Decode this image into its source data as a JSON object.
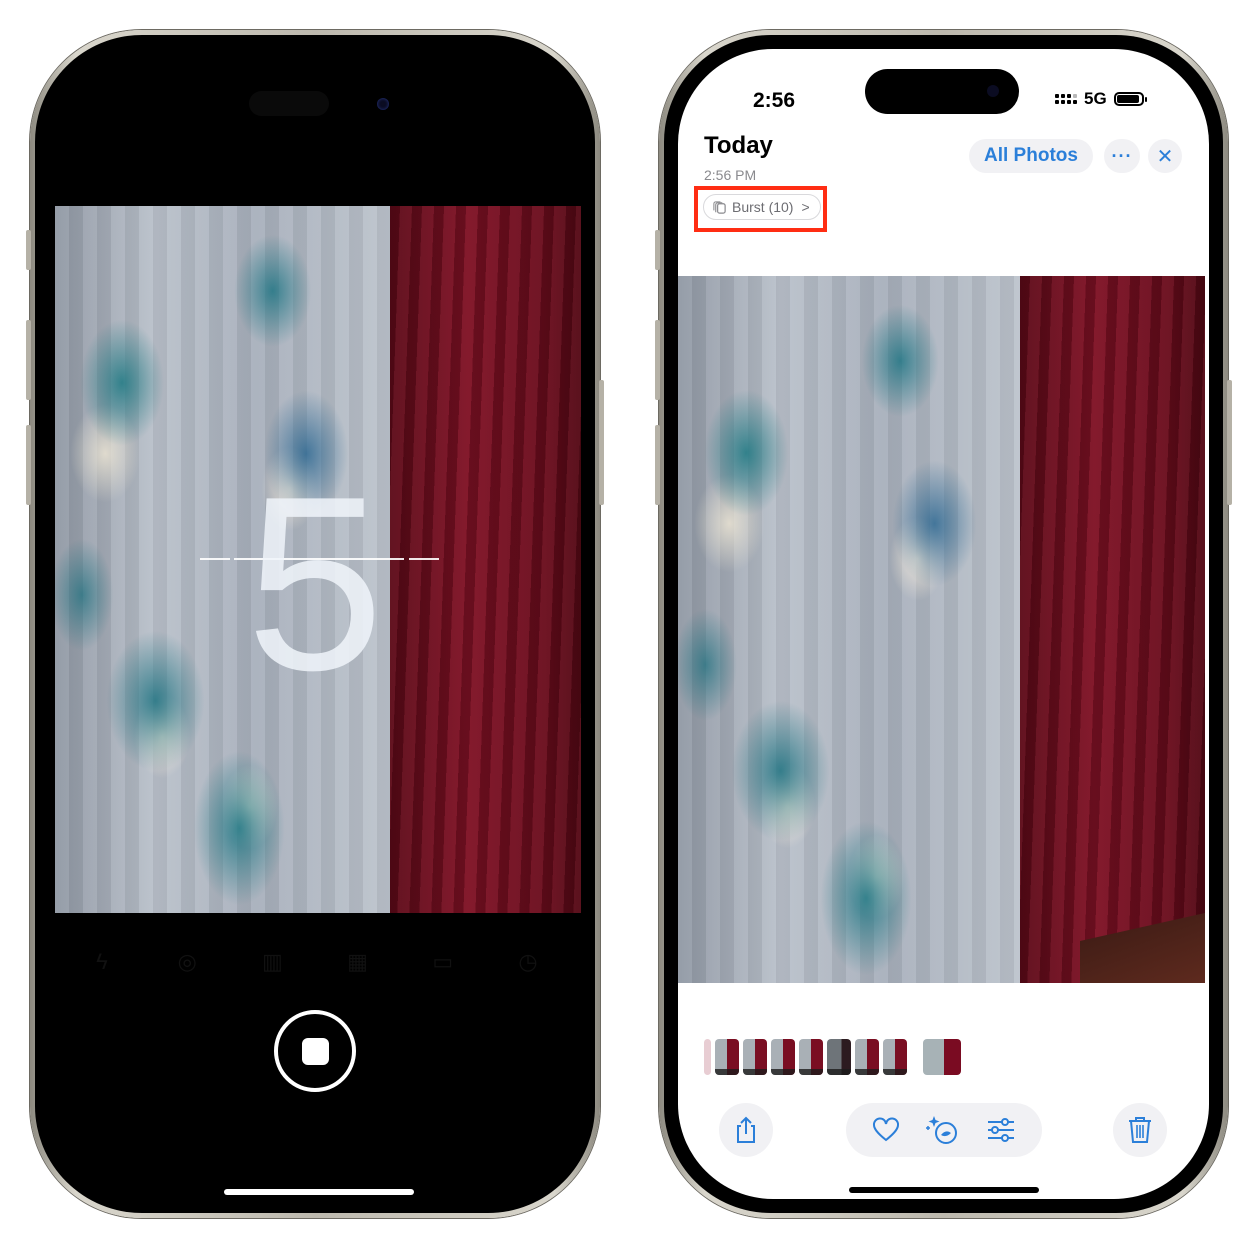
{
  "left_phone": {
    "screen": "camera-burst-countdown",
    "countdown_number": "5",
    "camera_controls": [
      "flash-icon",
      "live-photo-icon",
      "exposure-icon",
      "styles-icon",
      "aspect-ratio-icon",
      "timer-icon"
    ],
    "shutter_state": "recording-stop"
  },
  "right_phone": {
    "status_bar": {
      "time": "2:56",
      "network": "5G",
      "signal_bars": 4
    },
    "header": {
      "title": "Today",
      "subtitle": "2:56 PM",
      "burst_chip": {
        "label": "Burst (10)",
        "icon": "burst-stack-icon",
        "chevron": ">"
      },
      "all_photos_label": "All Photos",
      "more_label": "···",
      "close_label": "✕"
    },
    "highlight_color": "#ff2d13",
    "accent_color": "#2b7fd9",
    "burst_thumbnails": {
      "count": 10,
      "selected_index": 8
    },
    "toolbar": [
      "share-icon",
      "heart-icon",
      "clean-up-icon",
      "adjust-icon",
      "trash-icon"
    ]
  }
}
